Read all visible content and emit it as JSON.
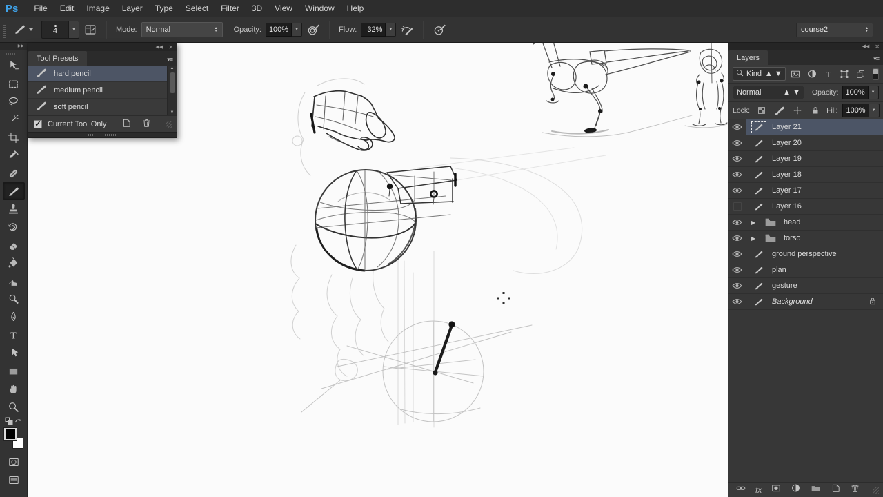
{
  "app": {
    "logo": "Ps",
    "workspace": "course2"
  },
  "menubar": {
    "items": [
      "File",
      "Edit",
      "Image",
      "Layer",
      "Type",
      "Select",
      "Filter",
      "3D",
      "View",
      "Window",
      "Help"
    ]
  },
  "options_bar": {
    "brush_size": "4",
    "mode_label": "Mode:",
    "mode_value": "Normal",
    "opacity_label": "Opacity:",
    "opacity_value": "100%",
    "flow_label": "Flow:",
    "flow_value": "32%"
  },
  "toolbar": {
    "tools": [
      {
        "name": "move-tool",
        "icon": "move"
      },
      {
        "name": "marquee-tool",
        "icon": "marquee"
      },
      {
        "name": "lasso-tool",
        "icon": "lasso"
      },
      {
        "name": "magic-wand-tool",
        "icon": "wand"
      },
      {
        "name": "crop-tool",
        "icon": "crop"
      },
      {
        "name": "eyedropper-tool",
        "icon": "eyedropper"
      },
      {
        "name": "healing-brush-tool",
        "icon": "healing"
      },
      {
        "name": "brush-tool",
        "icon": "brush",
        "selected": true
      },
      {
        "name": "clone-stamp-tool",
        "icon": "stamp"
      },
      {
        "name": "history-brush-tool",
        "icon": "history"
      },
      {
        "name": "eraser-tool",
        "icon": "eraser"
      },
      {
        "name": "paint-bucket-tool",
        "icon": "bucket"
      },
      {
        "name": "smudge-tool",
        "icon": "smudge"
      },
      {
        "name": "dodge-tool",
        "icon": "dodge"
      },
      {
        "name": "pen-tool",
        "icon": "pen"
      },
      {
        "name": "type-tool",
        "icon": "type"
      },
      {
        "name": "path-selection-tool",
        "icon": "pathsel"
      },
      {
        "name": "shape-tool",
        "icon": "shape"
      },
      {
        "name": "hand-tool",
        "icon": "hand"
      },
      {
        "name": "zoom-tool",
        "icon": "zoomtool"
      }
    ]
  },
  "tool_presets": {
    "title": "Tool Presets",
    "items": [
      {
        "label": "hard pencil",
        "selected": true
      },
      {
        "label": "medium pencil",
        "selected": false
      },
      {
        "label": "soft pencil",
        "selected": false
      }
    ],
    "current_tool_only_label": "Current Tool Only",
    "current_tool_only_checked": "✓"
  },
  "layers_panel": {
    "title": "Layers",
    "kind_label": "Kind",
    "blend_mode": "Normal",
    "opacity_label": "Opacity:",
    "opacity_value": "100%",
    "lock_label": "Lock:",
    "fill_label": "Fill:",
    "fill_value": "100%",
    "layers": [
      {
        "name": "Layer 21",
        "type": "layer",
        "visible": true,
        "selected": true
      },
      {
        "name": "Layer 20",
        "type": "layer",
        "visible": true
      },
      {
        "name": "Layer 19",
        "type": "layer",
        "visible": true
      },
      {
        "name": "Layer 18",
        "type": "layer",
        "visible": true
      },
      {
        "name": "Layer 17",
        "type": "layer",
        "visible": true
      },
      {
        "name": "Layer 16",
        "type": "layer",
        "visible": false
      },
      {
        "name": "head",
        "type": "group",
        "visible": true
      },
      {
        "name": "torso",
        "type": "group",
        "visible": true
      },
      {
        "name": "ground perspective",
        "type": "layer",
        "visible": true
      },
      {
        "name": "plan",
        "type": "layer",
        "visible": true
      },
      {
        "name": "gesture",
        "type": "layer",
        "visible": true
      },
      {
        "name": "Background",
        "type": "background",
        "visible": true,
        "locked": true
      }
    ],
    "bottom_icons": [
      "link",
      "fx",
      "mask",
      "adjust",
      "group",
      "newlayer",
      "trash"
    ]
  },
  "colors": {
    "accent_selection": "#4c5566",
    "canvas": "#fbfbfb",
    "chrome": "#333333",
    "logo_blue": "#3fa2e8"
  }
}
